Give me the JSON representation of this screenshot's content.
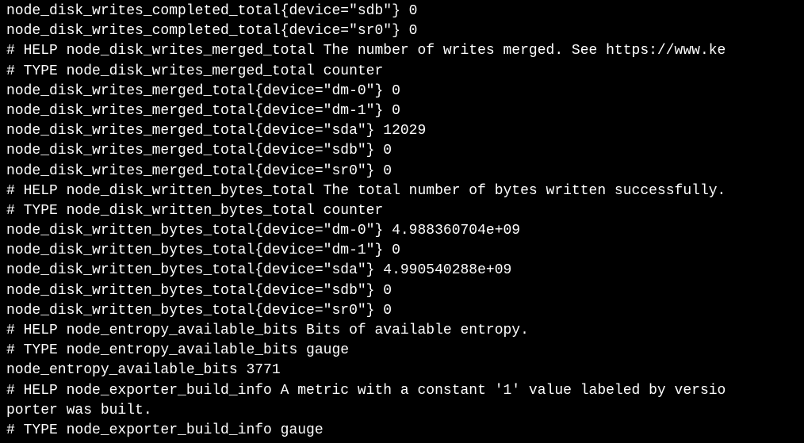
{
  "lines": [
    "node_disk_writes_completed_total{device=\"sdb\"} 0",
    "node_disk_writes_completed_total{device=\"sr0\"} 0",
    "# HELP node_disk_writes_merged_total The number of writes merged. See https://www.ke",
    "# TYPE node_disk_writes_merged_total counter",
    "node_disk_writes_merged_total{device=\"dm-0\"} 0",
    "node_disk_writes_merged_total{device=\"dm-1\"} 0",
    "node_disk_writes_merged_total{device=\"sda\"} 12029",
    "node_disk_writes_merged_total{device=\"sdb\"} 0",
    "node_disk_writes_merged_total{device=\"sr0\"} 0",
    "# HELP node_disk_written_bytes_total The total number of bytes written successfully.",
    "# TYPE node_disk_written_bytes_total counter",
    "node_disk_written_bytes_total{device=\"dm-0\"} 4.988360704e+09",
    "node_disk_written_bytes_total{device=\"dm-1\"} 0",
    "node_disk_written_bytes_total{device=\"sda\"} 4.990540288e+09",
    "node_disk_written_bytes_total{device=\"sdb\"} 0",
    "node_disk_written_bytes_total{device=\"sr0\"} 0",
    "# HELP node_entropy_available_bits Bits of available entropy.",
    "# TYPE node_entropy_available_bits gauge",
    "node_entropy_available_bits 3771",
    "# HELP node_exporter_build_info A metric with a constant '1' value labeled by versio",
    "porter was built.",
    "# TYPE node_exporter_build_info gauge"
  ]
}
